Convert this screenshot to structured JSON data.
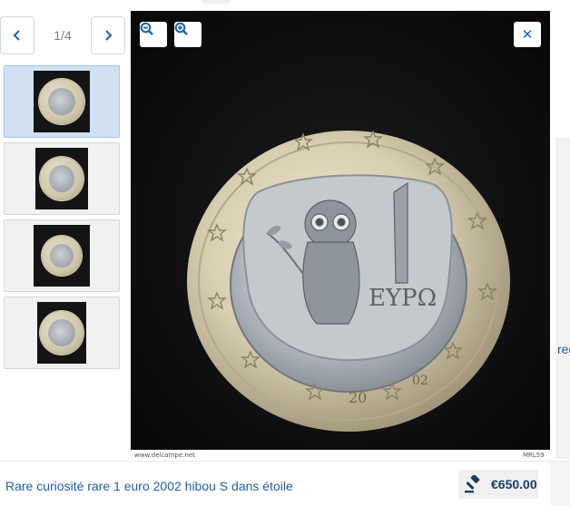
{
  "gallery": {
    "pager": {
      "current": "1/4",
      "prev_icon": "chevron-left-icon",
      "next_icon": "chevron-right-icon"
    },
    "thumbnails": [
      {
        "name": "coin-photo-1",
        "active": true
      },
      {
        "name": "coin-photo-2",
        "active": false
      },
      {
        "name": "coin-photo-3",
        "active": false
      },
      {
        "name": "coin-photo-4",
        "active": false
      }
    ]
  },
  "viewer": {
    "toolbar": {
      "zoom_out_icon": "zoom-out-icon",
      "zoom_in_icon": "zoom-in-icon",
      "close_icon": "close-icon"
    },
    "coin_inscription": "ΕΥΡΩ",
    "coin_year_left": "20",
    "coin_year_right": "02",
    "credit_left": "www.delcampe.net",
    "credit_right": "MRL59"
  },
  "page": {
    "partial_link": "reg"
  },
  "listing": {
    "title": "Rare curiosité rare 1 euro 2002 hibou S dans étoile",
    "price": "€650.00",
    "price_icon": "gavel-icon"
  },
  "colors": {
    "accent": "#1f5fa8",
    "active_thumb": "#cfe1f3",
    "viewer_bg": "#0e0f10"
  }
}
